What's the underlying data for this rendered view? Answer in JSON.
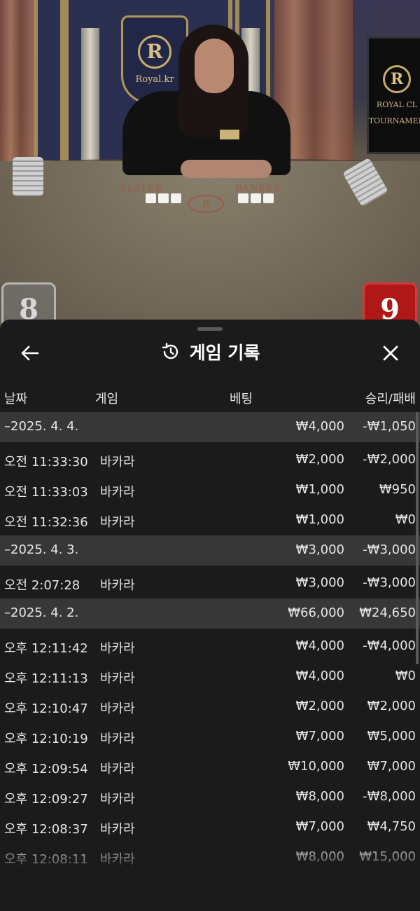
{
  "video": {
    "logo_letter": "R",
    "logo_text": "Royal.kr",
    "monitor_text_1": "ROYAL CL",
    "monitor_text_2": "TOURNAMEN",
    "table_player_label": "PLAYER",
    "table_banker_label": "BANKER",
    "table_center_logo": "R",
    "player_score": "8",
    "banker_score": "9"
  },
  "sheet": {
    "title": "게임 기록",
    "back_icon": "back-arrow-icon",
    "history_icon": "history-icon",
    "close_icon": "close-icon",
    "columns": {
      "date": "날짜",
      "game": "게임",
      "bet": "베팅",
      "result": "승리/패배"
    },
    "rows": [
      {
        "type": "date",
        "date": "–2025. 4. 4.",
        "game": "",
        "bet": "₩4,000",
        "result": "-₩1,050"
      },
      {
        "type": "entry",
        "date": "오전 11:33:30",
        "game": "바카라",
        "bet": "₩2,000",
        "result": "-₩2,000"
      },
      {
        "type": "entry",
        "date": "오전 11:33:03",
        "game": "바카라",
        "bet": "₩1,000",
        "result": "₩950"
      },
      {
        "type": "entry",
        "date": "오전 11:32:36",
        "game": "바카라",
        "bet": "₩1,000",
        "result": "₩0"
      },
      {
        "type": "date",
        "date": "–2025. 4. 3.",
        "game": "",
        "bet": "₩3,000",
        "result": "-₩3,000"
      },
      {
        "type": "entry",
        "date": "오전 2:07:28",
        "game": "바카라",
        "bet": "₩3,000",
        "result": "-₩3,000"
      },
      {
        "type": "date",
        "date": "–2025. 4. 2.",
        "game": "",
        "bet": "₩66,000",
        "result": "₩24,650"
      },
      {
        "type": "entry",
        "date": "오후 12:11:42",
        "game": "바카라",
        "bet": "₩4,000",
        "result": "-₩4,000"
      },
      {
        "type": "entry",
        "date": "오후 12:11:13",
        "game": "바카라",
        "bet": "₩4,000",
        "result": "₩0"
      },
      {
        "type": "entry",
        "date": "오후 12:10:47",
        "game": "바카라",
        "bet": "₩2,000",
        "result": "₩2,000"
      },
      {
        "type": "entry",
        "date": "오후 12:10:19",
        "game": "바카라",
        "bet": "₩7,000",
        "result": "₩5,000"
      },
      {
        "type": "entry",
        "date": "오후 12:09:54",
        "game": "바카라",
        "bet": "₩10,000",
        "result": "₩7,000"
      },
      {
        "type": "entry",
        "date": "오후 12:09:27",
        "game": "바카라",
        "bet": "₩8,000",
        "result": "-₩8,000"
      },
      {
        "type": "entry",
        "date": "오후 12:08:37",
        "game": "바카라",
        "bet": "₩7,000",
        "result": "₩4,750"
      },
      {
        "type": "entry",
        "date": "오후 12:08:11",
        "game": "바카라",
        "bet": "₩8,000",
        "result": "₩15,000"
      }
    ]
  },
  "colors": {
    "sheet_bg": "#1b1b1b",
    "date_row_bg": "#373737",
    "banker_red": "#b01818",
    "text": "#e6e6e6"
  }
}
